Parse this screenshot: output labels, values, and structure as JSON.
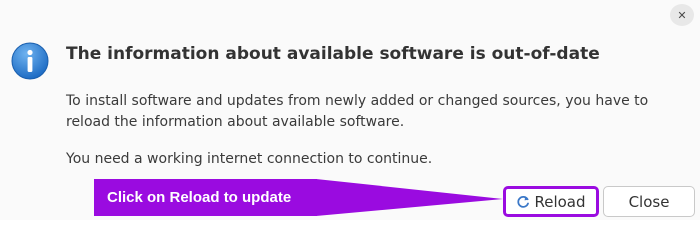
{
  "dialog": {
    "close_glyph": "✕",
    "title": "The information about available software is out-of-date",
    "body_line_1": "To install software and updates from newly added or changed sources, you have to reload the information about available software.",
    "body_line_2": "You need a working internet connection to continue.",
    "icon": "info-icon"
  },
  "buttons": {
    "reload_label": "Reload",
    "reload_icon": "reload-icon",
    "close_label": "Close"
  },
  "annotation": {
    "callout_text": "Click on Reload to update",
    "highlight_color": "#9a0be0"
  },
  "colors": {
    "info_icon_blue": "#2a7fd4",
    "reload_icon_blue": "#3b78c8"
  }
}
